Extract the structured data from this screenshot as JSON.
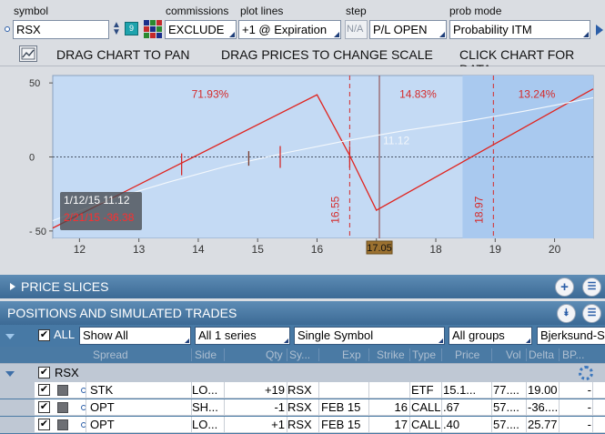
{
  "controls": {
    "symbol_label": "symbol",
    "symbol_value": "RSX",
    "symbol_badge": "9",
    "commissions_label": "commissions",
    "commissions_value": "EXCLUDE",
    "plotlines_label": "plot lines",
    "plotlines_value": "+1 @ Expiration",
    "step_label": "step",
    "step_value": "N/A",
    "pl_value": "P/L OPEN",
    "probmode_label": "prob mode",
    "probmode_value": "Probability ITM"
  },
  "infobar": {
    "drag_pan": "DRAG CHART TO PAN",
    "drag_scale": "DRAG PRICES TO CHANGE SCALE",
    "click_data": "CLICK CHART FOR DATA"
  },
  "chart_data": {
    "type": "line",
    "x_ticks": [
      "12",
      "13",
      "14",
      "15",
      "16",
      "17",
      "18",
      "19",
      "20"
    ],
    "y_ticks": [
      "50",
      "0",
      "- 50"
    ],
    "xlim": [
      11.55,
      20.65
    ],
    "ylim": [
      -55,
      55
    ],
    "series": [
      {
        "color": "#e0241f",
        "x": [
          11.55,
          16.0,
          16.55,
          17.0,
          20.65
        ],
        "y": [
          -48.0,
          42.0,
          1.0,
          -36.0,
          46.0
        ]
      },
      {
        "color": "#f4f8fc",
        "x": [
          11.55,
          12.5,
          13.5,
          14.5,
          15.5,
          16.5,
          17.5,
          18.5,
          19.5,
          20.65
        ],
        "y": [
          -43.0,
          -29.0,
          -17.0,
          -6.0,
          3.0,
          11.0,
          18.0,
          24.0,
          31.0,
          40.0
        ]
      }
    ],
    "probabilities": [
      {
        "label": "71.93%",
        "x": 14.2
      },
      {
        "label": "14.83%",
        "x": 17.7
      },
      {
        "label": "13.24%",
        "x": 19.7
      }
    ],
    "breakevens": [
      {
        "label": "16.55",
        "x": 16.55
      },
      {
        "label": "18.97",
        "x": 18.97
      }
    ],
    "current_price": {
      "label": "17.05",
      "x": 17.05
    },
    "theo_label": {
      "label": "11.12",
      "x": 17.05,
      "y": 11.12
    },
    "tooltip": {
      "line1": "1/12/15 11.12",
      "line2": "2/21/15 -36.38"
    },
    "colors": {
      "background": "#c4daf4",
      "shaded_region": "#a9c9ef",
      "pl_line": "#e0241f",
      "theo_line": "#f4f8fc",
      "current_price_badge": "#9b7130"
    }
  },
  "price_slices": {
    "title": "PRICE SLICES"
  },
  "positions": {
    "title": "POSITIONS AND SIMULATED TRADES",
    "filters": {
      "all_label": "ALL",
      "show_all": "Show All",
      "series": "All 1 series",
      "symbol_mode": "Single Symbol",
      "groups": "All groups",
      "model": "Bjerksund-St"
    },
    "columns": [
      "Spread",
      "Side",
      "Qty",
      "Sy...",
      "Exp",
      "Strike",
      "Type",
      "Price",
      "Vol",
      "Delta",
      "BP..."
    ],
    "group_label": "RSX",
    "rows": [
      {
        "spread": "STK",
        "side": "LO...",
        "qty": "+19",
        "symbol": "RSX",
        "exp": "",
        "strike": "",
        "type": "ETF",
        "price": "15.1...",
        "vol": "77....",
        "delta": "19.00",
        "bp": "-"
      },
      {
        "spread": "OPT",
        "side": "SH...",
        "qty": "-1",
        "symbol": "RSX",
        "exp": "FEB 15",
        "strike": "16",
        "type": "CALL",
        "price": ".67",
        "vol": "57....",
        "delta": "-36....",
        "bp": "-"
      },
      {
        "spread": "OPT",
        "side": "LO...",
        "qty": "+1",
        "symbol": "RSX",
        "exp": "FEB 15",
        "strike": "17",
        "type": "CALL",
        "price": ".40",
        "vol": "57....",
        "delta": "25.77",
        "bp": "-"
      }
    ]
  }
}
